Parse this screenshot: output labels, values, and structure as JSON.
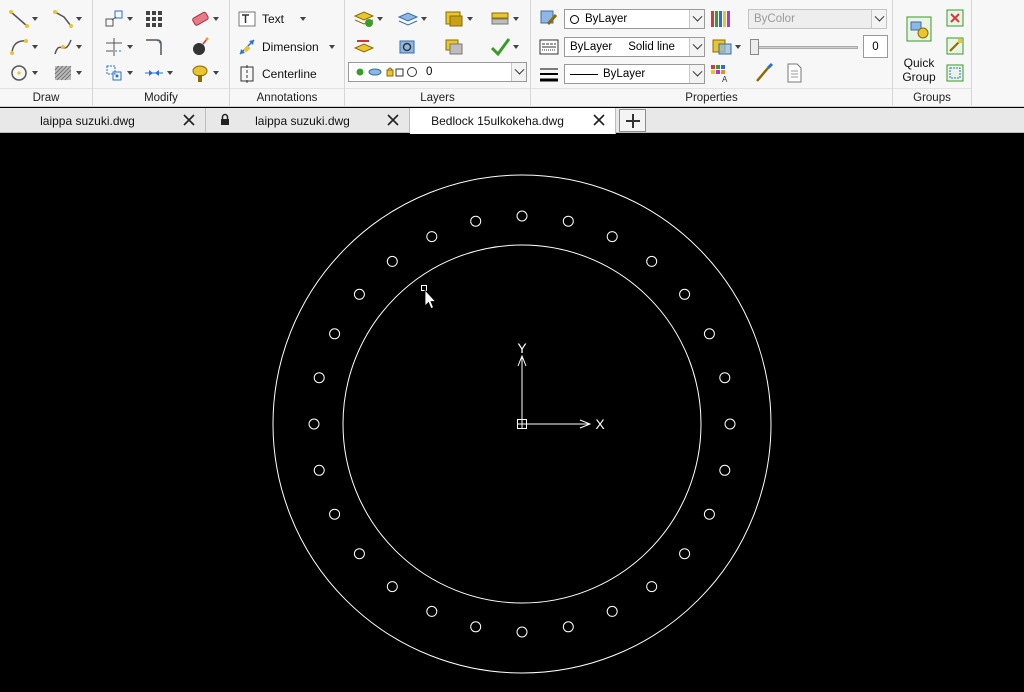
{
  "ribbon": {
    "panels": {
      "draw": "Draw",
      "modify": "Modify",
      "annotations": "Annotations",
      "layers": "Layers",
      "properties": "Properties",
      "groups": "Groups"
    },
    "annotations": {
      "text": "Text",
      "dimension": "Dimension",
      "centerline": "Centerline"
    },
    "layers": {
      "current_layer": "0"
    },
    "properties": {
      "color": "ByLayer",
      "linetype_layer": "ByLayer",
      "linetype_style": "Solid line",
      "lineweight": "ByLayer",
      "plot_style": "ByColor",
      "transparency": "0"
    },
    "groups": {
      "quick_group_line1": "Quick",
      "quick_group_line2": "Group"
    }
  },
  "tabs": [
    {
      "name": "laippa suzuki.dwg",
      "locked": false,
      "active": false
    },
    {
      "name": "laippa suzuki.dwg",
      "locked": true,
      "active": false
    },
    {
      "name": "Bedlock 15ulkokeha.dwg",
      "locked": false,
      "active": true
    }
  ],
  "drawing": {
    "ucs_x_label": "X",
    "ucs_y_label": "Y",
    "outer_circle_color": "#ffffff",
    "bolt_hole_count": 28
  },
  "colors": {
    "canvas_bg": "#000000",
    "ribbon_bg": "#f7f7f7",
    "accent_green": "#3a9a2a",
    "accent_yellow": "#e8c531"
  }
}
